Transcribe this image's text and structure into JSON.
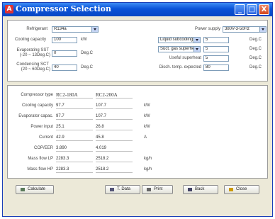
{
  "window": {
    "title": "Compressor Selection",
    "icon": "A"
  },
  "titlebar_buttons": {
    "minimize": "_",
    "maximize": "□",
    "close": "X"
  },
  "inputs": {
    "refrigerant_label": "Refrigerant",
    "refrigerant_value": "R134a",
    "cooling_capacity_label": "Cooling capacity",
    "cooling_capacity_value": "100",
    "cooling_capacity_unit": "kW",
    "evap_sct_label_1": "Evaporating SST",
    "evap_sct_label_2": "(-20 ~ 13Deg.C)",
    "evap_sct_value": "0",
    "evap_sct_unit": "Deg.C",
    "cond_sct_label_1": "Condensing SCT",
    "cond_sct_label_2": "(20 ~ 60Deg.C)",
    "cond_sct_value": "40",
    "cond_sct_unit": "Deg.C",
    "power_supply_label": "Power supply",
    "power_supply_value": "380V-3-50Hz",
    "liquid_subcooling_label": "Liquid subcooling",
    "liquid_subcooling_value": "5",
    "liquid_subcooling_unit": "Deg.C",
    "suct_superheat_label": "Suct. gas superheat",
    "suct_superheat_value": "5",
    "suct_superheat_unit": "Deg.C",
    "useful_superheat_label": "Useful superheat",
    "useful_superheat_value": "5",
    "useful_superheat_unit": "Deg.C",
    "disch_temp_label": "Disch. temp. expected",
    "disch_temp_value": "80",
    "disch_temp_unit": "Deg.C"
  },
  "results": {
    "rows": [
      {
        "label": "Compressor type",
        "col1": "RC2-180A",
        "col2": "RC2-200A",
        "unit": ""
      },
      {
        "label": "Cooling capacity",
        "col1": "97.7",
        "col2": "107.7",
        "unit": "kW"
      },
      {
        "label": "Evaporator capac.",
        "col1": "97.7",
        "col2": "107.7",
        "unit": "kW"
      },
      {
        "label": "Power input",
        "col1": "25.1",
        "col2": "26.8",
        "unit": "kW"
      },
      {
        "label": "Current",
        "col1": "42.9",
        "col2": "45.8",
        "unit": "A"
      },
      {
        "label": "COP/EER",
        "col1": "3.890",
        "col2": "4.019",
        "unit": ""
      },
      {
        "label": "Mass flow LP",
        "col1": "2283.3",
        "col2": "2518.2",
        "unit": "kg/h"
      },
      {
        "label": "Mass flow HP",
        "col1": "2283.3",
        "col2": "2518.2",
        "unit": "kg/h"
      }
    ]
  },
  "buttons": {
    "calculate": "Calculate",
    "tdata": "T. Data",
    "print": "Print",
    "back": "Back",
    "close": "Close"
  },
  "colors": {
    "titlebar": "#0a52d8",
    "window_bg": "#ece9d8",
    "panel_bg": "#ffffff"
  }
}
